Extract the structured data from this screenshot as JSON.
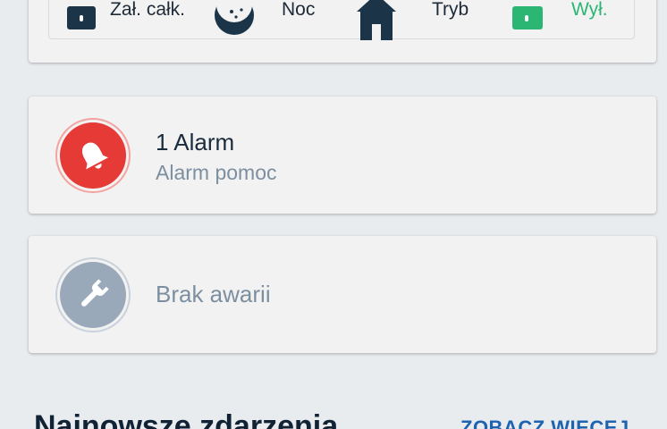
{
  "modes": [
    {
      "label": "Zał. całk.",
      "icon": "lock-icon"
    },
    {
      "label": "Noc",
      "icon": "moon-stars-icon"
    },
    {
      "label": "Tryb",
      "icon": "house-icon"
    },
    {
      "label": "Wył.",
      "icon": "unlock-icon",
      "color": "#2bb673"
    }
  ],
  "alarm_card": {
    "title": "1 Alarm",
    "subtitle": "Alarm pomoc",
    "icon": "bell-icon",
    "color": "#e53a35"
  },
  "fault_card": {
    "title": "Brak awarii",
    "icon": "wrench-icon",
    "color": "#9aa9ba"
  },
  "recent_events": {
    "title": "Najnowsze zdarzenia",
    "see_more_label": "ZOBACZ WIĘCEJ"
  }
}
